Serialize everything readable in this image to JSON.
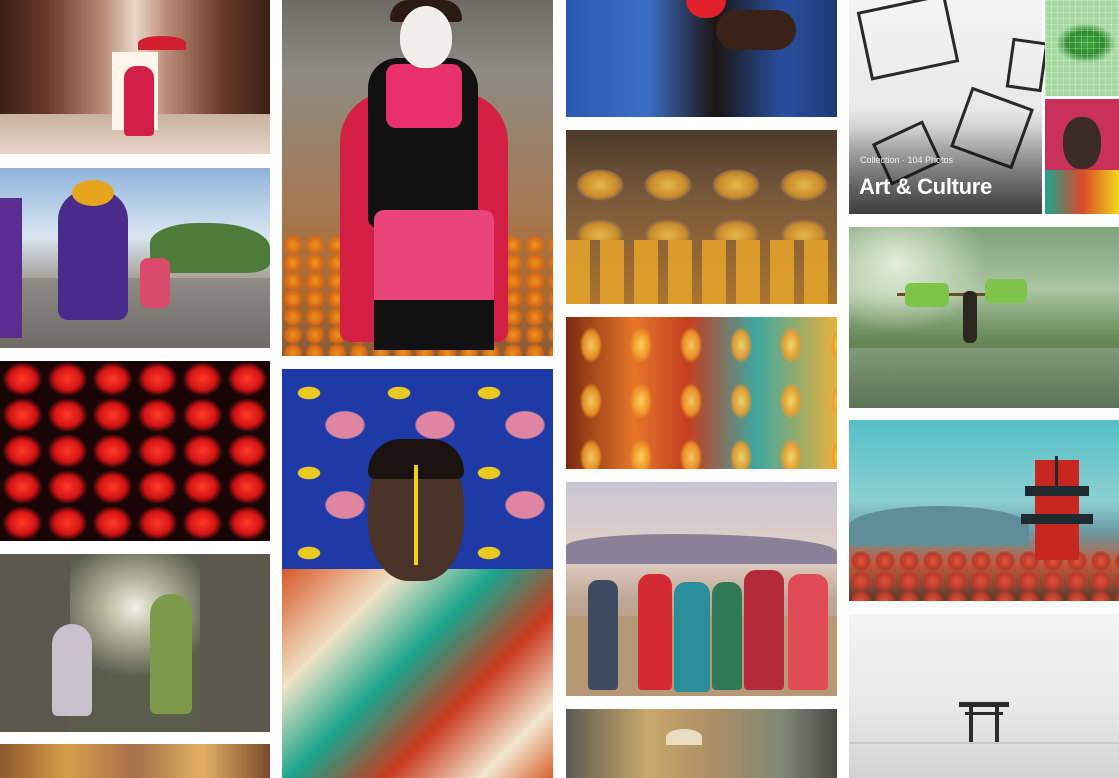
{
  "collection": {
    "meta": "Collection · 104 Photos",
    "title": "Art & Culture"
  }
}
